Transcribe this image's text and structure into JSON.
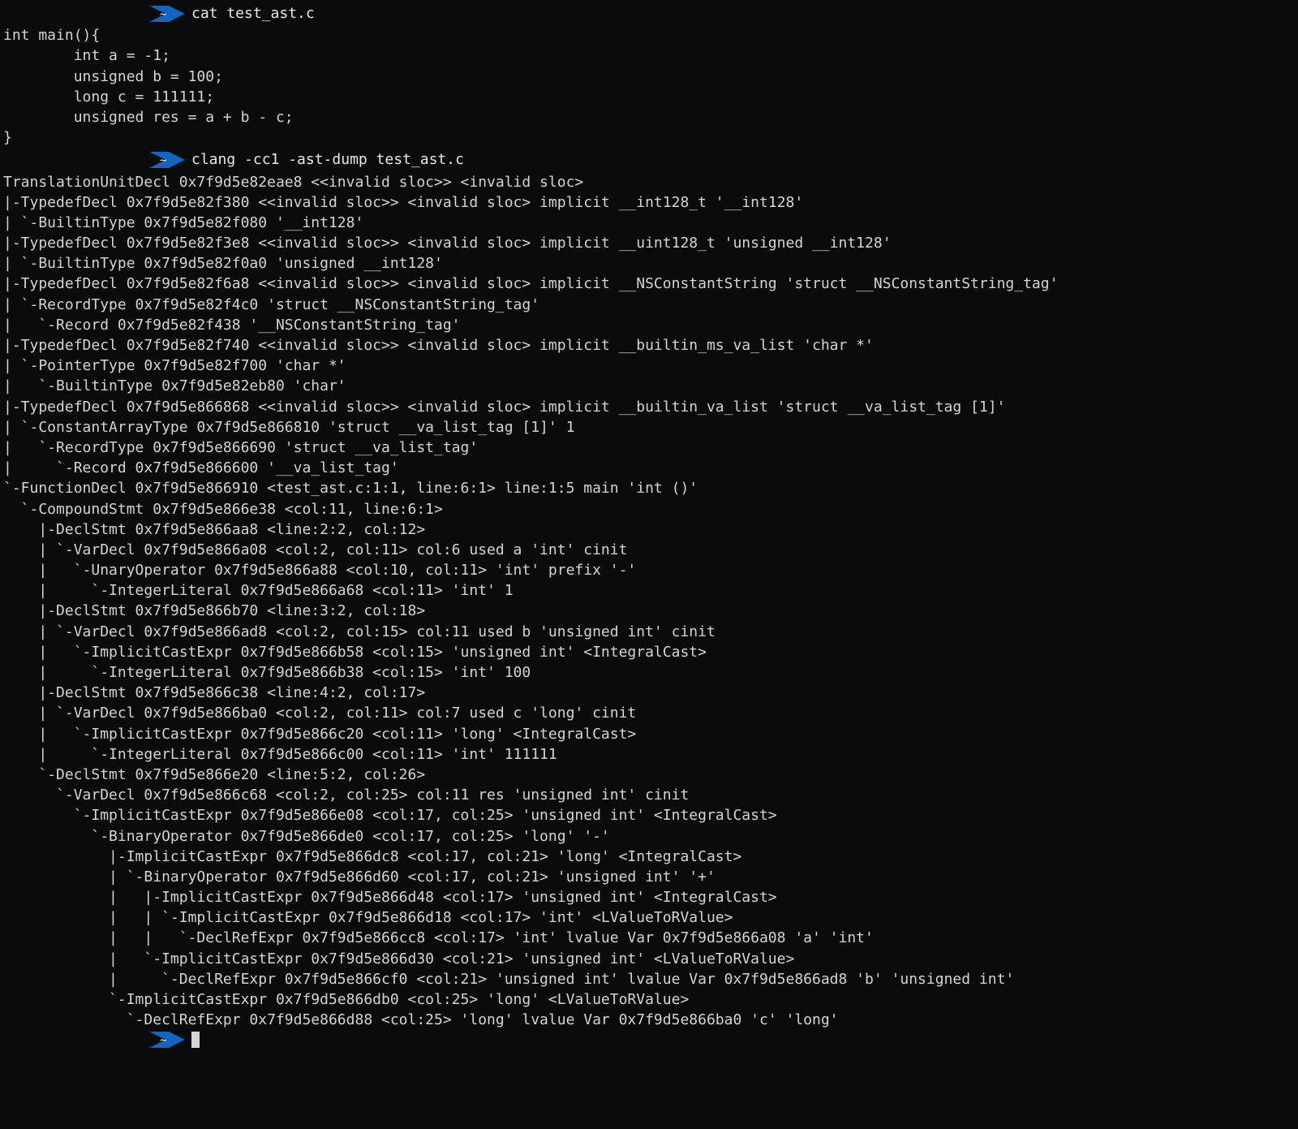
{
  "prompt1": {
    "command": "cat test_ast.c"
  },
  "source_code": [
    "int main(){",
    "        int a = -1;",
    "        unsigned b = 100;",
    "        long c = 111111;",
    "        unsigned res = a + b - c;",
    "}"
  ],
  "prompt2": {
    "command": "clang -cc1 -ast-dump test_ast.c"
  },
  "ast_output": [
    "TranslationUnitDecl 0x7f9d5e82eae8 <<invalid sloc>> <invalid sloc>",
    "|-TypedefDecl 0x7f9d5e82f380 <<invalid sloc>> <invalid sloc> implicit __int128_t '__int128'",
    "| `-BuiltinType 0x7f9d5e82f080 '__int128'",
    "|-TypedefDecl 0x7f9d5e82f3e8 <<invalid sloc>> <invalid sloc> implicit __uint128_t 'unsigned __int128'",
    "| `-BuiltinType 0x7f9d5e82f0a0 'unsigned __int128'",
    "|-TypedefDecl 0x7f9d5e82f6a8 <<invalid sloc>> <invalid sloc> implicit __NSConstantString 'struct __NSConstantString_tag'",
    "| `-RecordType 0x7f9d5e82f4c0 'struct __NSConstantString_tag'",
    "|   `-Record 0x7f9d5e82f438 '__NSConstantString_tag'",
    "|-TypedefDecl 0x7f9d5e82f740 <<invalid sloc>> <invalid sloc> implicit __builtin_ms_va_list 'char *'",
    "| `-PointerType 0x7f9d5e82f700 'char *'",
    "|   `-BuiltinType 0x7f9d5e82eb80 'char'",
    "|-TypedefDecl 0x7f9d5e866868 <<invalid sloc>> <invalid sloc> implicit __builtin_va_list 'struct __va_list_tag [1]'",
    "| `-ConstantArrayType 0x7f9d5e866810 'struct __va_list_tag [1]' 1",
    "|   `-RecordType 0x7f9d5e866690 'struct __va_list_tag'",
    "|     `-Record 0x7f9d5e866600 '__va_list_tag'",
    "`-FunctionDecl 0x7f9d5e866910 <test_ast.c:1:1, line:6:1> line:1:5 main 'int ()'",
    "  `-CompoundStmt 0x7f9d5e866e38 <col:11, line:6:1>",
    "    |-DeclStmt 0x7f9d5e866aa8 <line:2:2, col:12>",
    "    | `-VarDecl 0x7f9d5e866a08 <col:2, col:11> col:6 used a 'int' cinit",
    "    |   `-UnaryOperator 0x7f9d5e866a88 <col:10, col:11> 'int' prefix '-'",
    "    |     `-IntegerLiteral 0x7f9d5e866a68 <col:11> 'int' 1",
    "    |-DeclStmt 0x7f9d5e866b70 <line:3:2, col:18>",
    "    | `-VarDecl 0x7f9d5e866ad8 <col:2, col:15> col:11 used b 'unsigned int' cinit",
    "    |   `-ImplicitCastExpr 0x7f9d5e866b58 <col:15> 'unsigned int' <IntegralCast>",
    "    |     `-IntegerLiteral 0x7f9d5e866b38 <col:15> 'int' 100",
    "    |-DeclStmt 0x7f9d5e866c38 <line:4:2, col:17>",
    "    | `-VarDecl 0x7f9d5e866ba0 <col:2, col:11> col:7 used c 'long' cinit",
    "    |   `-ImplicitCastExpr 0x7f9d5e866c20 <col:11> 'long' <IntegralCast>",
    "    |     `-IntegerLiteral 0x7f9d5e866c00 <col:11> 'int' 111111",
    "    `-DeclStmt 0x7f9d5e866e20 <line:5:2, col:26>",
    "      `-VarDecl 0x7f9d5e866c68 <col:2, col:25> col:11 res 'unsigned int' cinit",
    "        `-ImplicitCastExpr 0x7f9d5e866e08 <col:17, col:25> 'unsigned int' <IntegralCast>",
    "          `-BinaryOperator 0x7f9d5e866de0 <col:17, col:25> 'long' '-'",
    "            |-ImplicitCastExpr 0x7f9d5e866dc8 <col:17, col:21> 'long' <IntegralCast>",
    "            | `-BinaryOperator 0x7f9d5e866d60 <col:17, col:21> 'unsigned int' '+'",
    "            |   |-ImplicitCastExpr 0x7f9d5e866d48 <col:17> 'unsigned int' <IntegralCast>",
    "            |   | `-ImplicitCastExpr 0x7f9d5e866d18 <col:17> 'int' <LValueToRValue>",
    "            |   |   `-DeclRefExpr 0x7f9d5e866cc8 <col:17> 'int' lvalue Var 0x7f9d5e866a08 'a' 'int'",
    "            |   `-ImplicitCastExpr 0x7f9d5e866d30 <col:21> 'unsigned int' <LValueToRValue>",
    "            |     `-DeclRefExpr 0x7f9d5e866cf0 <col:21> 'unsigned int' lvalue Var 0x7f9d5e866ad8 'b' 'unsigned int'",
    "            `-ImplicitCastExpr 0x7f9d5e866db0 <col:25> 'long' <LValueToRValue>",
    "              `-DeclRefExpr 0x7f9d5e866d88 <col:25> 'long' lvalue Var 0x7f9d5e866ba0 'c' 'long'"
  ]
}
